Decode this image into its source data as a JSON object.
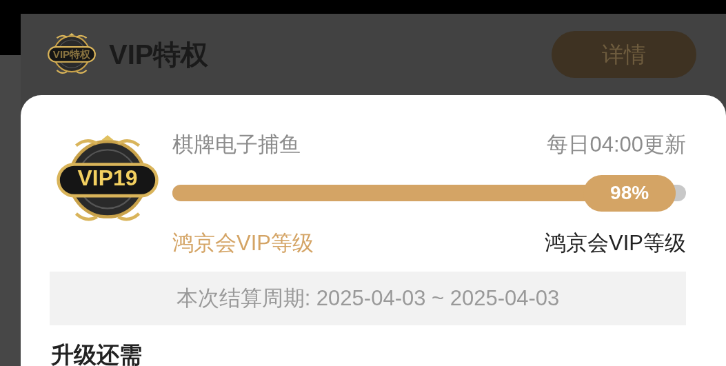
{
  "header": {
    "badge": "VIP特权",
    "title": "VIP特权",
    "details_button": "详情"
  },
  "card": {
    "badge": "VIP19",
    "category": "棋牌电子捕鱼",
    "update_note": "每日04:00更新",
    "progress": {
      "level": 0.98,
      "reading": "98%"
    },
    "current_level_label": "鸿京会VIP等级",
    "next_level_label": "鸿京会VIP等级",
    "period": "本次结算周期: 2025-04-03 ~ 2025-04-03",
    "section_title": "升级还需"
  }
}
